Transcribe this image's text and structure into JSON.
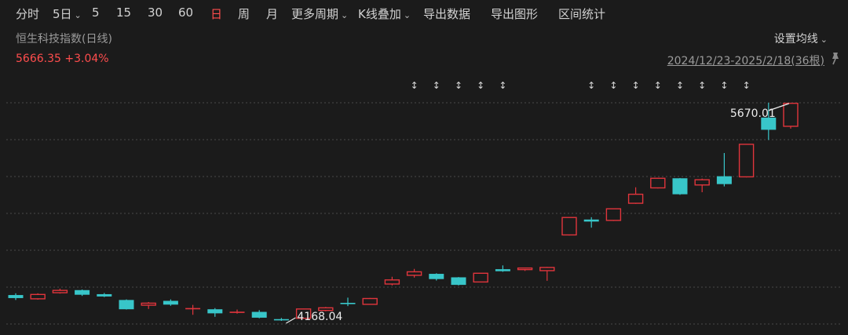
{
  "toolbar": {
    "items": [
      "分时",
      "5日",
      "5",
      "15",
      "30",
      "60",
      "日",
      "周",
      "月",
      "更多周期",
      "K线叠加",
      "导出数据",
      "导出图形",
      "区间统计"
    ],
    "active": "日"
  },
  "header": {
    "index_name": "恒生科技指数(日线)",
    "price": "5666.35",
    "change": "+3.04%",
    "ma_settings": "设置均线",
    "date_range": "2024/12/23-2025/2/18(36根)"
  },
  "colors": {
    "up": "#e0353c",
    "down": "#38c6c9",
    "background": "#1b1b1b",
    "grid": "#4a4a4a"
  },
  "icons": [
    "chevron-down-icon",
    "pin-icon",
    "up-down-arrow-icon",
    "arrow-icon"
  ],
  "chart_data": {
    "type": "candlestick",
    "count": 36,
    "candles": [
      {
        "o": 4346,
        "c": 4325,
        "h": 4358,
        "l": 4312
      },
      {
        "o": 4320,
        "c": 4350,
        "h": 4358,
        "l": 4314
      },
      {
        "o": 4362,
        "c": 4378,
        "h": 4390,
        "l": 4356
      },
      {
        "o": 4380,
        "c": 4348,
        "h": 4384,
        "l": 4340
      },
      {
        "o": 4352,
        "c": 4336,
        "h": 4360,
        "l": 4332
      },
      {
        "o": 4312,
        "c": 4248,
        "h": 4316,
        "l": 4246
      },
      {
        "o": 4276,
        "c": 4290,
        "h": 4298,
        "l": 4250
      },
      {
        "o": 4306,
        "c": 4280,
        "h": 4316,
        "l": 4272
      },
      {
        "o": 4252,
        "c": 4252,
        "h": 4278,
        "l": 4210
      },
      {
        "o": 4248,
        "c": 4220,
        "h": 4256,
        "l": 4196
      },
      {
        "o": 4227,
        "c": 4227,
        "h": 4246,
        "l": 4218
      },
      {
        "o": 4230,
        "c": 4190,
        "h": 4242,
        "l": 4186
      },
      {
        "o": 4176,
        "c": 4176,
        "h": 4188,
        "l": 4168
      },
      {
        "o": 4186,
        "c": 4250,
        "h": 4252,
        "l": 4182
      },
      {
        "o": 4240,
        "c": 4258,
        "h": 4264,
        "l": 4234
      },
      {
        "o": 4288,
        "c": 4288,
        "h": 4328,
        "l": 4270
      },
      {
        "o": 4282,
        "c": 4322,
        "h": 4326,
        "l": 4280
      },
      {
        "o": 4422,
        "c": 4450,
        "h": 4472,
        "l": 4412
      },
      {
        "o": 4482,
        "c": 4506,
        "h": 4526,
        "l": 4466
      },
      {
        "o": 4492,
        "c": 4456,
        "h": 4496,
        "l": 4446
      },
      {
        "o": 4468,
        "c": 4416,
        "h": 4470,
        "l": 4412
      },
      {
        "o": 4436,
        "c": 4496,
        "h": 4498,
        "l": 4434
      },
      {
        "o": 4524,
        "c": 4510,
        "h": 4550,
        "l": 4506
      },
      {
        "o": 4530,
        "c": 4532,
        "h": 4534,
        "l": 4512
      },
      {
        "o": 4514,
        "c": 4536,
        "h": 4540,
        "l": 4444
      },
      {
        "o": 4760,
        "c": 4880,
        "h": 4882,
        "l": 4756
      },
      {
        "o": 4866,
        "c": 4852,
        "h": 4882,
        "l": 4810
      },
      {
        "o": 4860,
        "c": 4940,
        "h": 4942,
        "l": 4856
      },
      {
        "o": 4978,
        "c": 5040,
        "h": 5088,
        "l": 4974
      },
      {
        "o": 5084,
        "c": 5150,
        "h": 5152,
        "l": 5080
      },
      {
        "o": 5150,
        "c": 5040,
        "h": 5152,
        "l": 5036
      },
      {
        "o": 5104,
        "c": 5140,
        "h": 5148,
        "l": 5054
      },
      {
        "o": 5164,
        "c": 5110,
        "h": 5324,
        "l": 5094
      },
      {
        "o": 5160,
        "c": 5384,
        "h": 5386,
        "l": 5156
      },
      {
        "o": 5568,
        "c": 5484,
        "h": 5670.01,
        "l": 5414
      },
      {
        "o": 5508,
        "c": 5666.35,
        "h": 5670,
        "l": 5492
      }
    ],
    "min_label": "4168.04",
    "max_label": "5670.01",
    "marker_candles": [
      18,
      19,
      20,
      21,
      22,
      26,
      27,
      28,
      29,
      30,
      31,
      32,
      33
    ]
  }
}
